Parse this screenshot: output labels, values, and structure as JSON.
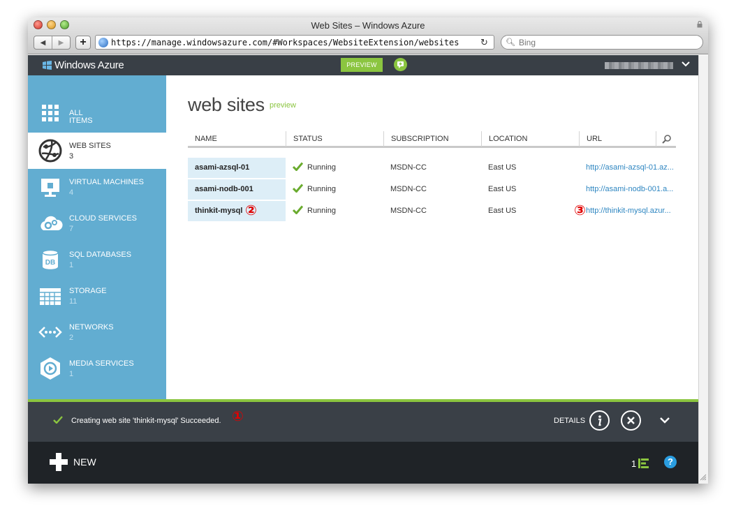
{
  "browser": {
    "window_title": "Web Sites – Windows Azure",
    "url": "https://manage.windowsazure.com/#Workspaces/WebsiteExtension/websites",
    "search_placeholder": "Bing"
  },
  "topbar": {
    "logo_text": "Windows Azure",
    "preview_label": "PREVIEW"
  },
  "sidebar": {
    "items": [
      {
        "label_line1": "ALL",
        "label_line2": "ITEMS",
        "count": "",
        "icon": "grid-icon"
      },
      {
        "label_line1": "WEB SITES",
        "label_line2": "",
        "count": "3",
        "icon": "globe-icon"
      },
      {
        "label_line1": "VIRTUAL MACHINES",
        "label_line2": "",
        "count": "4",
        "icon": "monitor-icon"
      },
      {
        "label_line1": "CLOUD SERVICES",
        "label_line2": "",
        "count": "7",
        "icon": "cloud-gears-icon"
      },
      {
        "label_line1": "SQL DATABASES",
        "label_line2": "",
        "count": "1",
        "icon": "database-icon"
      },
      {
        "label_line1": "STORAGE",
        "label_line2": "",
        "count": "11",
        "icon": "table-icon"
      },
      {
        "label_line1": "NETWORKS",
        "label_line2": "",
        "count": "2",
        "icon": "network-icon"
      },
      {
        "label_line1": "MEDIA SERVICES",
        "label_line2": "",
        "count": "1",
        "icon": "media-icon"
      }
    ],
    "active_index": 1
  },
  "main": {
    "title": "web sites",
    "subtitle": "preview",
    "columns": [
      "NAME",
      "STATUS",
      "SUBSCRIPTION",
      "LOCATION",
      "URL"
    ],
    "rows": [
      {
        "name": "asami-azsql-01",
        "status": "Running",
        "subscription": "MSDN-CC",
        "location": "East US",
        "url": "http://asami-azsql-01.az..."
      },
      {
        "name": "asami-nodb-001",
        "status": "Running",
        "subscription": "MSDN-CC",
        "location": "East US",
        "url": "http://asami-nodb-001.a..."
      },
      {
        "name": "thinkit-mysql",
        "status": "Running",
        "subscription": "MSDN-CC",
        "location": "East US",
        "url": "http://thinkit-mysql.azur..."
      }
    ]
  },
  "annotations": {
    "callout_1": "①",
    "callout_2": "②",
    "callout_3": "③"
  },
  "notification": {
    "text": "Creating web site 'thinkit-mysql' Succeeded.",
    "details_label": "DETAILS"
  },
  "bottom": {
    "new_label": "NEW",
    "task_count": "1",
    "help_label": "?"
  },
  "colors": {
    "accent_green": "#8bc540",
    "sidebar_blue": "#62add1",
    "dark_bar": "#393f46",
    "link_blue": "#2e86c1",
    "callout_red": "#e00000"
  }
}
